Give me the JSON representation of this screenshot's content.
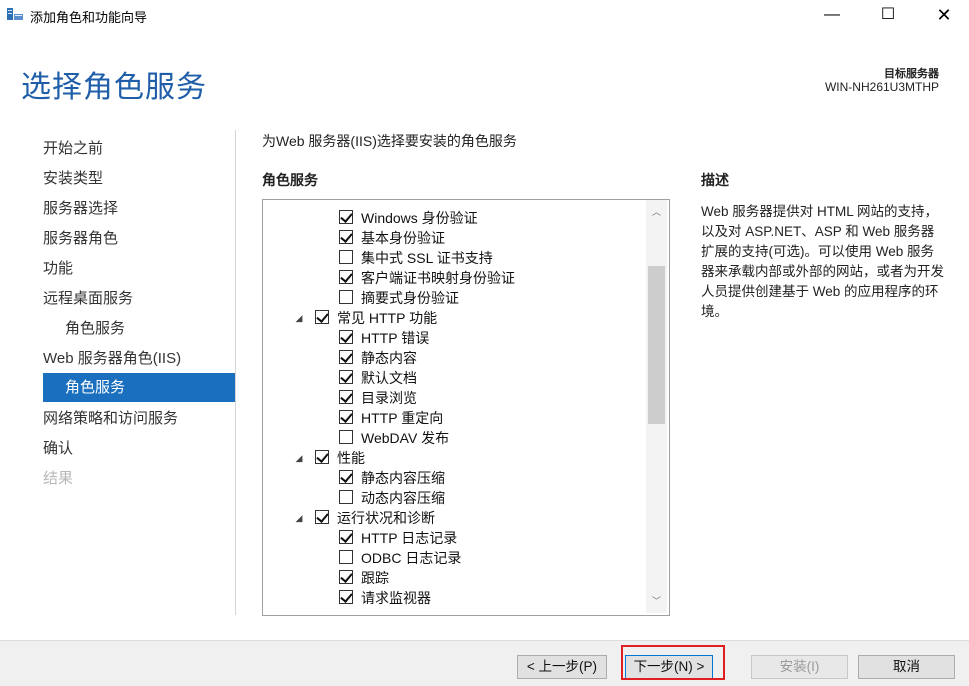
{
  "window": {
    "title": "添加角色和功能向导",
    "minimize": "—",
    "maximize": "☐",
    "close": "✕"
  },
  "header": {
    "page_title": "选择角色服务",
    "destination_label": "目标服务器",
    "destination_value": "WIN-NH261U3MTHP"
  },
  "nav": {
    "items": [
      {
        "label": "开始之前",
        "state": "normal"
      },
      {
        "label": "安装类型",
        "state": "normal"
      },
      {
        "label": "服务器选择",
        "state": "normal"
      },
      {
        "label": "服务器角色",
        "state": "normal"
      },
      {
        "label": "功能",
        "state": "normal"
      },
      {
        "label": "远程桌面服务",
        "state": "normal"
      },
      {
        "label": "角色服务",
        "state": "sub"
      },
      {
        "label": "Web 服务器角色(IIS)",
        "state": "normal"
      },
      {
        "label": "角色服务",
        "state": "active"
      },
      {
        "label": "网络策略和访问服务",
        "state": "normal"
      },
      {
        "label": "确认",
        "state": "normal"
      },
      {
        "label": "结果",
        "state": "disabled"
      }
    ]
  },
  "main": {
    "instruction": "为Web 服务器(IIS)选择要安装的角色服务",
    "section_label": "角色服务",
    "tree": [
      {
        "label": "Windows 身份验证",
        "checked": true,
        "level": 2
      },
      {
        "label": "基本身份验证",
        "checked": true,
        "level": 2
      },
      {
        "label": "集中式 SSL 证书支持",
        "checked": false,
        "level": 2
      },
      {
        "label": "客户端证书映射身份验证",
        "checked": true,
        "level": 2
      },
      {
        "label": "摘要式身份验证",
        "checked": false,
        "level": 2
      },
      {
        "label": "常见 HTTP 功能",
        "checked": true,
        "level": 1,
        "expander": "◢"
      },
      {
        "label": "HTTP 错误",
        "checked": true,
        "level": 2
      },
      {
        "label": "静态内容",
        "checked": true,
        "level": 2
      },
      {
        "label": "默认文档",
        "checked": true,
        "level": 2
      },
      {
        "label": "目录浏览",
        "checked": true,
        "level": 2
      },
      {
        "label": "HTTP 重定向",
        "checked": true,
        "level": 2
      },
      {
        "label": "WebDAV 发布",
        "checked": false,
        "level": 2
      },
      {
        "label": "性能",
        "checked": true,
        "level": 1,
        "expander": "◢"
      },
      {
        "label": "静态内容压缩",
        "checked": true,
        "level": 2
      },
      {
        "label": "动态内容压缩",
        "checked": false,
        "level": 2
      },
      {
        "label": "运行状况和诊断",
        "checked": true,
        "level": 1,
        "expander": "◢"
      },
      {
        "label": "HTTP 日志记录",
        "checked": true,
        "level": 2
      },
      {
        "label": "ODBC 日志记录",
        "checked": false,
        "level": 2
      },
      {
        "label": "跟踪",
        "checked": true,
        "level": 2
      },
      {
        "label": "请求监视器",
        "checked": true,
        "level": 2
      }
    ],
    "scroll_up": "︿",
    "scroll_down": "﹀"
  },
  "description": {
    "title": "描述",
    "text": "Web 服务器提供对 HTML 网站的支持，以及对 ASP.NET、ASP 和 Web 服务器扩展的支持(可选)。可以使用 Web 服务器来承载内部或外部的网站，或者为开发人员提供创建基于 Web 的应用程序的环境。"
  },
  "footer": {
    "prev": "< 上一步(P)",
    "next": "下一步(N) >",
    "install": "安装(I)",
    "cancel": "取消"
  },
  "colors": {
    "title_blue": "#1f5ea8",
    "nav_active": "#1a6fbf",
    "highlight_red": "#e02020"
  }
}
